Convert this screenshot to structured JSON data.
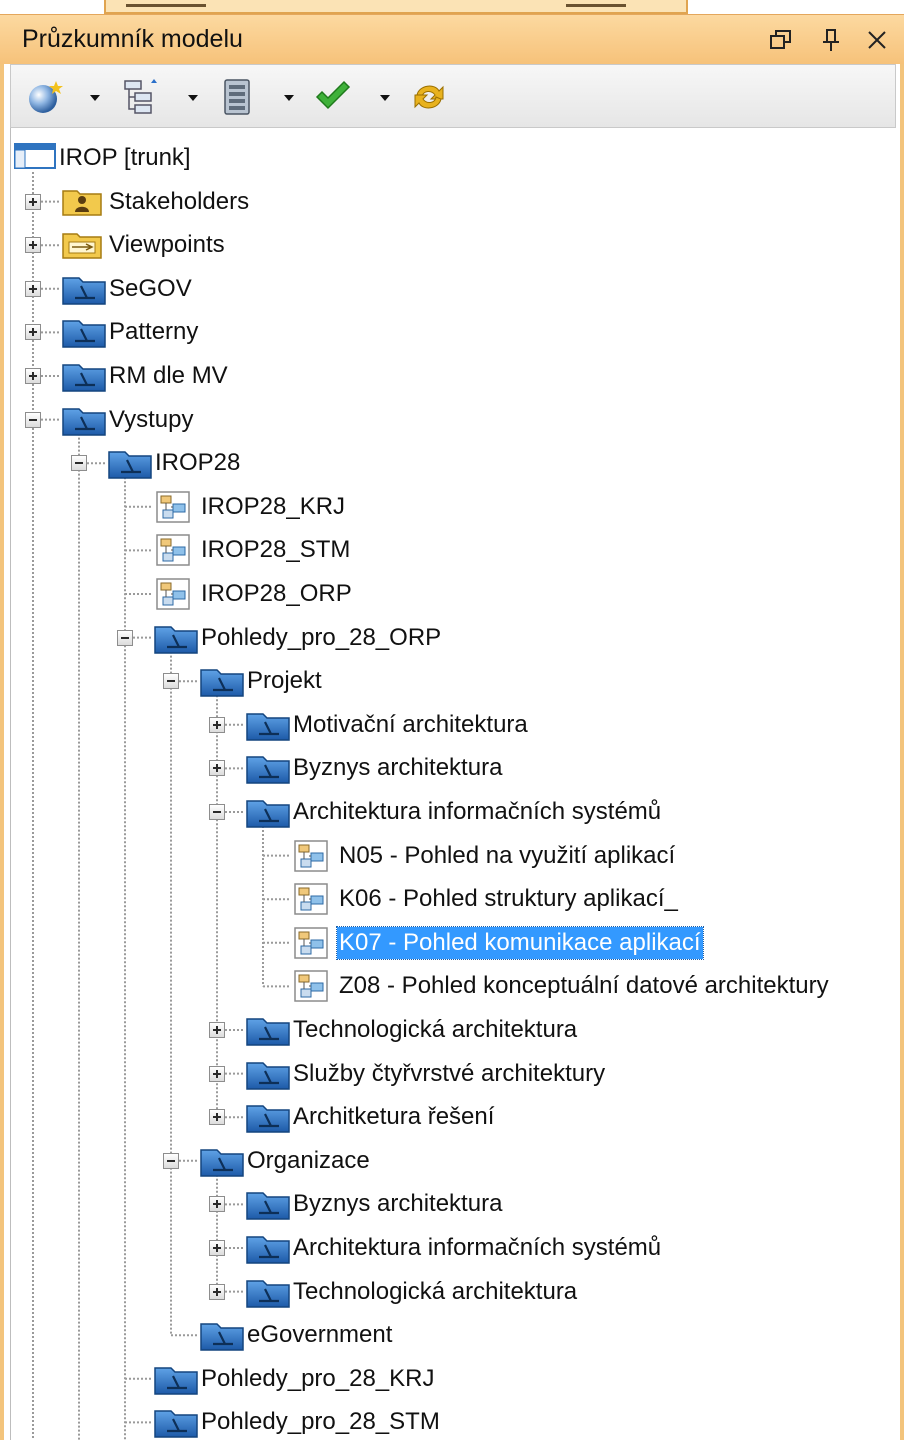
{
  "window": {
    "title": "Průzkumník modelu"
  },
  "title_buttons": [
    "restore-icon",
    "pin-icon",
    "close-icon"
  ],
  "toolbar": {
    "buttons": [
      "new-element-icon",
      "layout-tree-icon",
      "diagram-sheet-icon",
      "check-icon",
      "refresh-icon"
    ]
  },
  "colors": {
    "title_bar": "#f6c27a",
    "panel_border": "#f3c47c",
    "selection": "#3399ff",
    "folder_blue": "#2f74c0",
    "folder_yellow": "#f2c94c"
  },
  "tree": [
    {
      "label": "IROP [trunk]",
      "depth": 0,
      "icon": "project-icon",
      "toggle": "none"
    },
    {
      "label": "Stakeholders",
      "depth": 1,
      "icon": "stakeholder-folder-icon",
      "toggle": "plus"
    },
    {
      "label": "Viewpoints",
      "depth": 1,
      "icon": "viewpoint-folder-icon",
      "toggle": "plus"
    },
    {
      "label": "SeGOV",
      "depth": 1,
      "icon": "package-icon",
      "toggle": "plus"
    },
    {
      "label": "Patterny",
      "depth": 1,
      "icon": "package-icon",
      "toggle": "plus"
    },
    {
      "label": "RM dle MV",
      "depth": 1,
      "icon": "package-icon",
      "toggle": "plus"
    },
    {
      "label": "Vystupy",
      "depth": 1,
      "icon": "package-icon",
      "toggle": "minus"
    },
    {
      "label": "IROP28",
      "depth": 2,
      "icon": "package-icon",
      "toggle": "minus"
    },
    {
      "label": "IROP28_KRJ",
      "depth": 3,
      "icon": "diagram-icon",
      "toggle": "none"
    },
    {
      "label": "IROP28_STM",
      "depth": 3,
      "icon": "diagram-icon",
      "toggle": "none"
    },
    {
      "label": "IROP28_ORP",
      "depth": 3,
      "icon": "diagram-icon",
      "toggle": "none"
    },
    {
      "label": "Pohledy_pro_28_ORP",
      "depth": 3,
      "icon": "package-icon",
      "toggle": "minus"
    },
    {
      "label": "Projekt",
      "depth": 4,
      "icon": "package-icon",
      "toggle": "minus"
    },
    {
      "label": "Motivační architektura",
      "depth": 5,
      "icon": "package-icon",
      "toggle": "plus"
    },
    {
      "label": "Byznys architektura",
      "depth": 5,
      "icon": "package-icon",
      "toggle": "plus"
    },
    {
      "label": "Architektura informačních systémů",
      "depth": 5,
      "icon": "package-icon",
      "toggle": "minus"
    },
    {
      "label": "N05 - Pohled na využití aplikací",
      "depth": 6,
      "icon": "diagram-icon",
      "toggle": "none"
    },
    {
      "label": "K06 - Pohled struktury aplikací_",
      "depth": 6,
      "icon": "diagram-icon",
      "toggle": "none"
    },
    {
      "label": "K07 - Pohled komunikace aplikací",
      "depth": 6,
      "icon": "diagram-icon",
      "toggle": "none",
      "selected": true
    },
    {
      "label": "Z08 - Pohled konceptuální datové architektury",
      "depth": 6,
      "icon": "diagram-icon",
      "toggle": "none"
    },
    {
      "label": "Technologická architektura",
      "depth": 5,
      "icon": "package-icon",
      "toggle": "plus"
    },
    {
      "label": "Služby čtyřvrstvé architektury",
      "depth": 5,
      "icon": "package-icon",
      "toggle": "plus"
    },
    {
      "label": "Architketura řešení",
      "depth": 5,
      "icon": "package-icon",
      "toggle": "plus"
    },
    {
      "label": "Organizace",
      "depth": 4,
      "icon": "package-icon",
      "toggle": "minus"
    },
    {
      "label": "Byznys architektura",
      "depth": 5,
      "icon": "package-icon",
      "toggle": "plus"
    },
    {
      "label": "Architektura informačních systémů",
      "depth": 5,
      "icon": "package-icon",
      "toggle": "plus"
    },
    {
      "label": "Technologická architektura",
      "depth": 5,
      "icon": "package-icon",
      "toggle": "plus"
    },
    {
      "label": "eGovernment",
      "depth": 4,
      "icon": "package-icon",
      "toggle": "none"
    },
    {
      "label": "Pohledy_pro_28_KRJ",
      "depth": 3,
      "icon": "package-icon",
      "toggle": "none"
    },
    {
      "label": "Pohledy_pro_28_STM",
      "depth": 3,
      "icon": "package-icon",
      "toggle": "none"
    }
  ]
}
